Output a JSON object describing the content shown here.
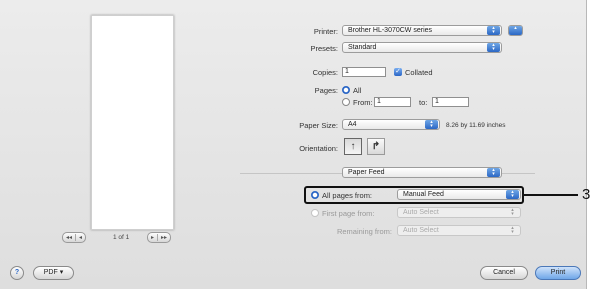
{
  "printer": {
    "label": "Printer:",
    "value": "Brother HL-3070CW series"
  },
  "presets": {
    "label": "Presets:",
    "value": "Standard"
  },
  "copies": {
    "label": "Copies:",
    "value": "1",
    "collated_label": "Collated",
    "collated": true
  },
  "pages": {
    "label": "Pages:",
    "all_label": "All",
    "from_label": "From:",
    "from_value": "1",
    "to_label": "to:",
    "to_value": "1",
    "selected": "All"
  },
  "paper_size": {
    "label": "Paper Size:",
    "value": "A4",
    "dimensions": "8.26 by 11.69 inches"
  },
  "orientation": {
    "label": "Orientation:"
  },
  "section": {
    "value": "Paper Feed"
  },
  "paper_feed": {
    "all_pages_label": "All pages from:",
    "all_pages_value": "Manual Feed",
    "first_page_label": "First page from:",
    "first_page_value": "Auto Select",
    "remaining_label": "Remaining from:",
    "remaining_value": "Auto Select"
  },
  "preview": {
    "page_indicator": "1 of 1"
  },
  "footer": {
    "help": "?",
    "pdf_label": "PDF ▾",
    "cancel_label": "Cancel",
    "print_label": "Print"
  },
  "callout": {
    "number": "3"
  },
  "colors": {
    "accent": "#2a66c6",
    "callout": "#111111"
  }
}
